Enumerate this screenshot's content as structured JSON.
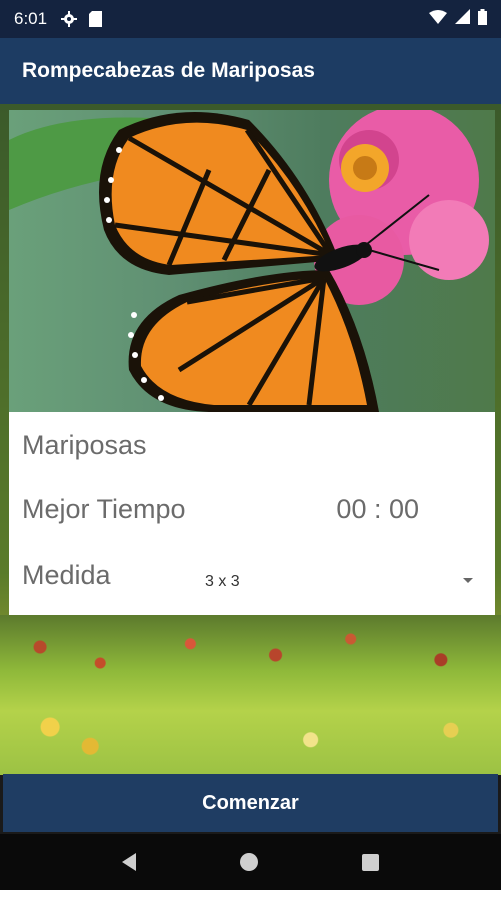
{
  "status_bar": {
    "time": "6:01",
    "icons": [
      "gear-icon",
      "sd-card-icon",
      "wifi-icon",
      "signal-icon",
      "battery-icon"
    ]
  },
  "app_bar": {
    "title": "Rompecabezas de Mariposas"
  },
  "card": {
    "category": "Mariposas",
    "best_time_label": "Mejor Tiempo",
    "best_time_value": "00 : 00",
    "size_label": "Medida",
    "size_value": "3 x 3"
  },
  "start_button": {
    "label": "Comenzar"
  },
  "colors": {
    "app_bar": "#1d3c63",
    "status_bar": "#14233f",
    "button": "#1f3d63",
    "card_text": "#6b6b6b"
  },
  "nav_bar": {
    "icons": [
      "back-icon",
      "home-icon",
      "recents-icon"
    ]
  }
}
